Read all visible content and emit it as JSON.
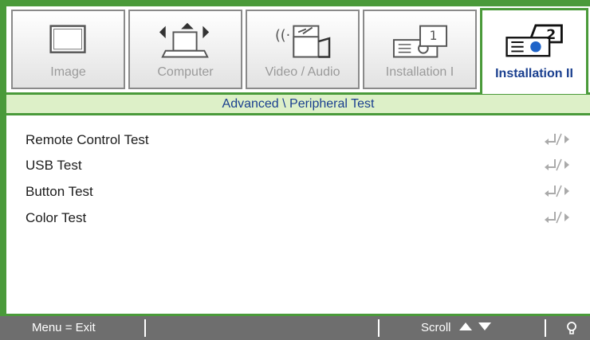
{
  "tabs": [
    {
      "label": "Image",
      "icon": "monitor-icon",
      "active": false
    },
    {
      "label": "Computer",
      "icon": "laptop-icon",
      "active": false
    },
    {
      "label": "Video / Audio",
      "icon": "video-audio-icon",
      "active": false
    },
    {
      "label": "Installation I",
      "icon": "projector-1-icon",
      "active": false
    },
    {
      "label": "Installation II",
      "icon": "projector-2-icon",
      "active": true
    }
  ],
  "breadcrumb": "Advanced \\ Peripheral Test",
  "items": [
    {
      "label": "Remote Control Test",
      "control_icon": "enter-arrow-icon"
    },
    {
      "label": "USB Test",
      "control_icon": "enter-arrow-icon"
    },
    {
      "label": "Button Test",
      "control_icon": "enter-arrow-icon"
    },
    {
      "label": "Color Test",
      "control_icon": "enter-arrow-icon"
    }
  ],
  "footer": {
    "exit_label": "Menu = Exit",
    "scroll_label": "Scroll"
  },
  "colors": {
    "accent_green": "#4a9a3a",
    "breadcrumb_bg": "#ddf0c8",
    "active_text": "#1a3f8f",
    "footer_bg": "#6e6e6e"
  }
}
